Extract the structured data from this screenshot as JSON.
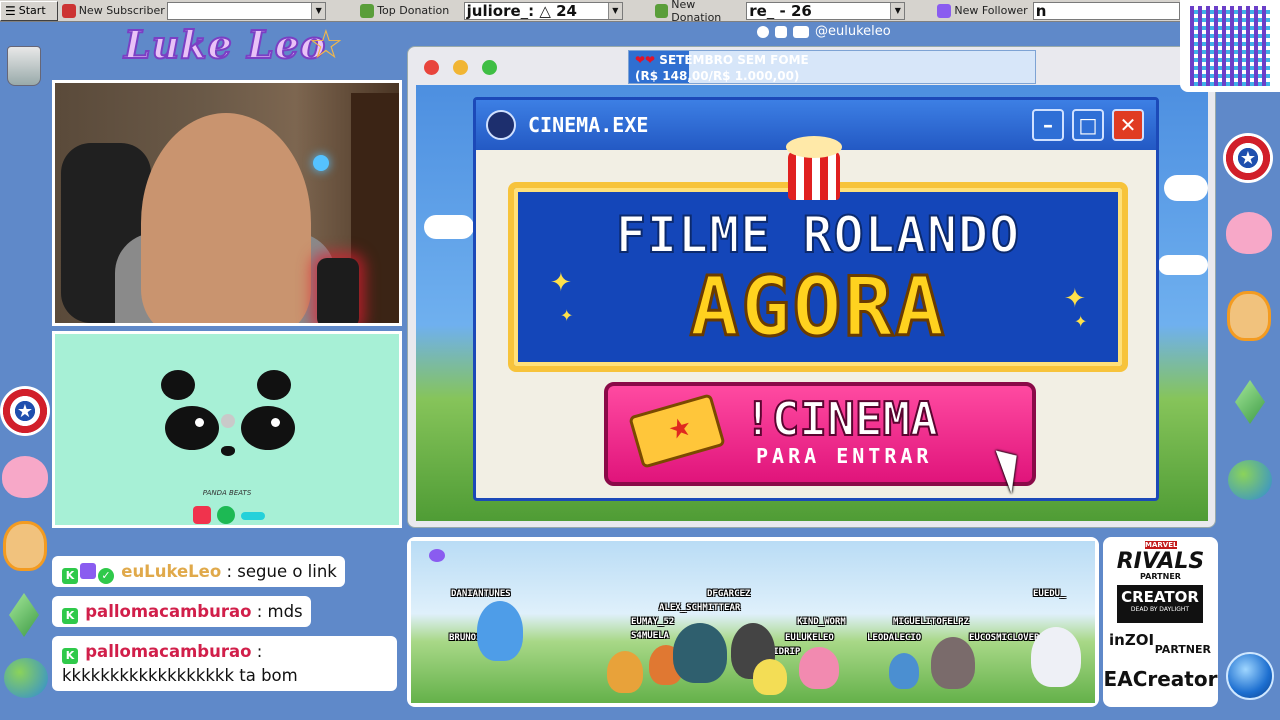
{
  "taskbar": {
    "start_label": "Start",
    "subscriber_label": "New Subscriber",
    "subscriber_value": "",
    "donation_label": "Top Donation",
    "donation_value": "juliore_: △ 24",
    "new_donation_label": "New Donation",
    "new_donation_value": "re_ - 26",
    "follower_label": "New Follower",
    "follower_value": "n"
  },
  "logo": {
    "text": "Luke Leo"
  },
  "social": {
    "handle": "@eulukeleo"
  },
  "donation_goal": {
    "title": "SETEMBRO SEM FOME",
    "amount": "(R$ 148,00/R$ 1.000,00)",
    "progress_fraction": 0.148
  },
  "panda": {
    "label": "PANDA BEATS"
  },
  "chat": {
    "messages": [
      {
        "user": "euLukeLeo",
        "text": " : segue o link",
        "user_color": "#e0a94a"
      },
      {
        "user": "pallomacamburao",
        "text": " : mds",
        "user_color": "#d11f4a"
      },
      {
        "user": "pallomacamburao",
        "text": " :",
        "text2": "kkkkkkkkkkkkkkkkkk ta bom",
        "user_color": "#d11f4a"
      }
    ]
  },
  "cinema": {
    "window_title": "CINEMA.EXE",
    "minimize": "–",
    "maximize": "□",
    "close": "✕",
    "line1": "FILME ROLANDO",
    "line2": "AGORA",
    "command": "!CINEMA",
    "subtext": "PARA ENTRAR"
  },
  "pokemon_names": [
    "DANIANTUNES",
    "DFGARCEZ",
    "ALEX_SCHMITTEAR",
    "EUMAY_52",
    "KIND_WORM",
    "MIGUELITOFELPZ",
    "EUEDU_",
    "BRUNOSIMOO",
    "S4MUELA",
    "EULUKELEO",
    "LEODALECIO",
    "EUCOSMICLOVER",
    "LARIDRIP"
  ],
  "partners": {
    "marvel": "MARVEL",
    "rivals": "RIVALS",
    "partner1": "PARTNER",
    "creator": "CREATOR",
    "dbd": "DEAD BY DAYLIGHT",
    "inzoi": "inZOI",
    "partner2": "PARTNER",
    "ea": "EACreator"
  },
  "colors": {
    "desktop": "#5f89c9",
    "cinema_pink": "#e0147b",
    "marquee_blue": "#1446b9",
    "marquee_yellow": "#ffd21f"
  }
}
